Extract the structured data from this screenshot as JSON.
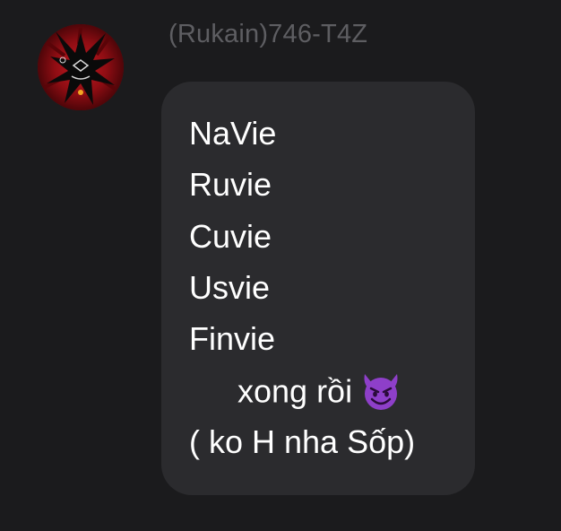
{
  "message": {
    "sender": "(Rukain)746-T4Z",
    "lines": [
      "NaVie",
      "Ruvie",
      "Cuvie",
      "Usvie",
      "Finvie",
      "xong rồi",
      "( ko H nha Sốp)"
    ],
    "emoji_icon": "smiling-devil-emoji"
  },
  "colors": {
    "background": "#1b1b1d",
    "bubble": "#2b2b2e",
    "text": "#ffffff",
    "sender": "#5e5e62",
    "avatar_red": "#7a0b10",
    "emoji_purple": "#8e3fc9"
  }
}
